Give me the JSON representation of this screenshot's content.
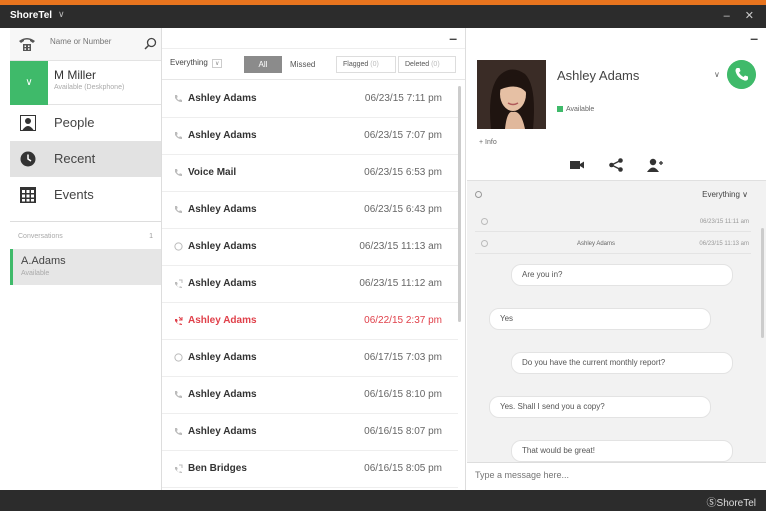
{
  "app": {
    "title": "ShoreTel",
    "menu_caret": "∨",
    "window_controls": "– ✕",
    "brand": "ⓈShoreTel"
  },
  "sidebar": {
    "search_placeholder": "Name or Number",
    "user": {
      "name": "M Miller",
      "status": "Available (Deskphone)",
      "toggle": "∨"
    },
    "nav": [
      {
        "label": "People",
        "icon": "person-icon"
      },
      {
        "label": "Recent",
        "icon": "recent-clock-icon"
      },
      {
        "label": "Events",
        "icon": "calendar-grid-icon"
      }
    ],
    "conversations_label": "Conversations",
    "conversations_count": "1",
    "conversation": {
      "name": "A.Adams",
      "status": "Available"
    }
  },
  "history": {
    "minimize": "–",
    "filter_select": "Everything",
    "filter_caret": "∨",
    "tabs": {
      "all": "All",
      "missed": "Missed",
      "flagged": "Flagged",
      "deleted": "Deleted"
    },
    "tab_counts": {
      "flagged": "(0)",
      "deleted": "(0)"
    },
    "rows": [
      {
        "name": "Ashley Adams",
        "date": "06/23/15  7:11  pm",
        "type": "call"
      },
      {
        "name": "Ashley Adams",
        "date": "06/23/15  7:07  pm",
        "type": "call"
      },
      {
        "name": "Voice Mail",
        "date": "06/23/15  6:53  pm",
        "type": "call"
      },
      {
        "name": "Ashley Adams",
        "date": "06/23/15  6:43  pm",
        "type": "call"
      },
      {
        "name": "Ashley Adams",
        "date": "06/23/15  11:13  am",
        "type": "chat"
      },
      {
        "name": "Ashley Adams",
        "date": "06/23/15  11:12  am",
        "type": "outgoing"
      },
      {
        "name": "Ashley Adams",
        "date": "06/22/15  2:37  pm",
        "type": "missed"
      },
      {
        "name": "Ashley Adams",
        "date": "06/17/15  7:03  pm",
        "type": "chat"
      },
      {
        "name": "Ashley Adams",
        "date": "06/16/15  8:10  pm",
        "type": "call"
      },
      {
        "name": "Ashley Adams",
        "date": "06/16/15  8:07  pm",
        "type": "call"
      },
      {
        "name": "Ben Bridges",
        "date": "06/16/15  8:05  pm",
        "type": "outgoing"
      }
    ]
  },
  "contact": {
    "minimize": "–",
    "name": "Ashley Adams",
    "status": "Available",
    "caret": "∨",
    "info_link": "+ Info",
    "actions": [
      "video-icon",
      "share-icon",
      "add-contact-icon"
    ]
  },
  "chat": {
    "filter": "Everything  ∨",
    "system_rows": [
      {
        "name": "",
        "time": "06/23/15 11:11 am"
      },
      {
        "name": "Ashley Adams",
        "time": "06/23/15 11:13 am"
      }
    ],
    "messages": [
      {
        "text": "Are you in?",
        "side": "in"
      },
      {
        "text": "Yes",
        "side": "out"
      },
      {
        "text": "Do you have the current monthly report?",
        "side": "in"
      },
      {
        "text": "Yes. Shall I send you a copy?",
        "side": "out"
      },
      {
        "text": "That would be great!",
        "side": "in"
      }
    ],
    "input_placeholder": "Type a message here..."
  },
  "colors": {
    "accent_green": "#3fba6a",
    "title_bar": "#2c2c2c",
    "missed_red": "#e0404a",
    "orange_strip": "#e8741e"
  }
}
